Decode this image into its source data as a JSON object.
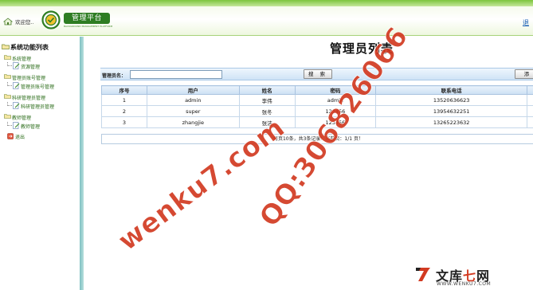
{
  "header": {
    "welcome_text": "欢迎您..",
    "logo_title": "管理平台",
    "logo_subtitle": "BACKGROUND MANAGEMENT PLATFORM",
    "exit_label": "退"
  },
  "sidebar": {
    "title": "系统功能列表",
    "groups": [
      {
        "label": "系统管理",
        "items": [
          {
            "label": "资源管理"
          }
        ]
      },
      {
        "label": "管理员账号管理",
        "items": [
          {
            "label": "管理员账号管理"
          }
        ]
      },
      {
        "label": "科研管理员管理",
        "items": [
          {
            "label": "科研管理员管理"
          }
        ]
      },
      {
        "label": "教师管理",
        "items": [
          {
            "label": "教师管理"
          }
        ]
      }
    ],
    "logout_label": "退出"
  },
  "main": {
    "title": "管理员列表",
    "search": {
      "label": "管理员名：",
      "value": "",
      "placeholder": "",
      "button_label": "搜 索",
      "add_button_label": "添"
    },
    "table": {
      "headers": [
        "序号",
        "用户",
        "姓名",
        "密码",
        "联系电话",
        ""
      ],
      "rows": [
        [
          "1",
          "admin",
          "李伟",
          "admin",
          "13520636623",
          ""
        ],
        [
          "2",
          "super",
          "张冬",
          "123456",
          "13954632251",
          ""
        ],
        [
          "3",
          "zhangjie",
          "张洁",
          "123456",
          "13265223632",
          ""
        ]
      ]
    },
    "pager_text": "每页10条，共3条记录！当前页：1/1 页！"
  },
  "watermarks": {
    "line1": "wenku7.com",
    "line2": "QQ:306826066"
  },
  "brand": {
    "name_prefix": "文库",
    "name_seven": "七",
    "name_suffix": "网",
    "url": "WWW.WENKU7.COM"
  },
  "colors": {
    "header_green": "#7cc53d",
    "logo_green": "#2e7d23",
    "tree_text": "#2d6e1c",
    "table_header_blue": "#cde0f3",
    "watermark_red": "#d23a21"
  }
}
